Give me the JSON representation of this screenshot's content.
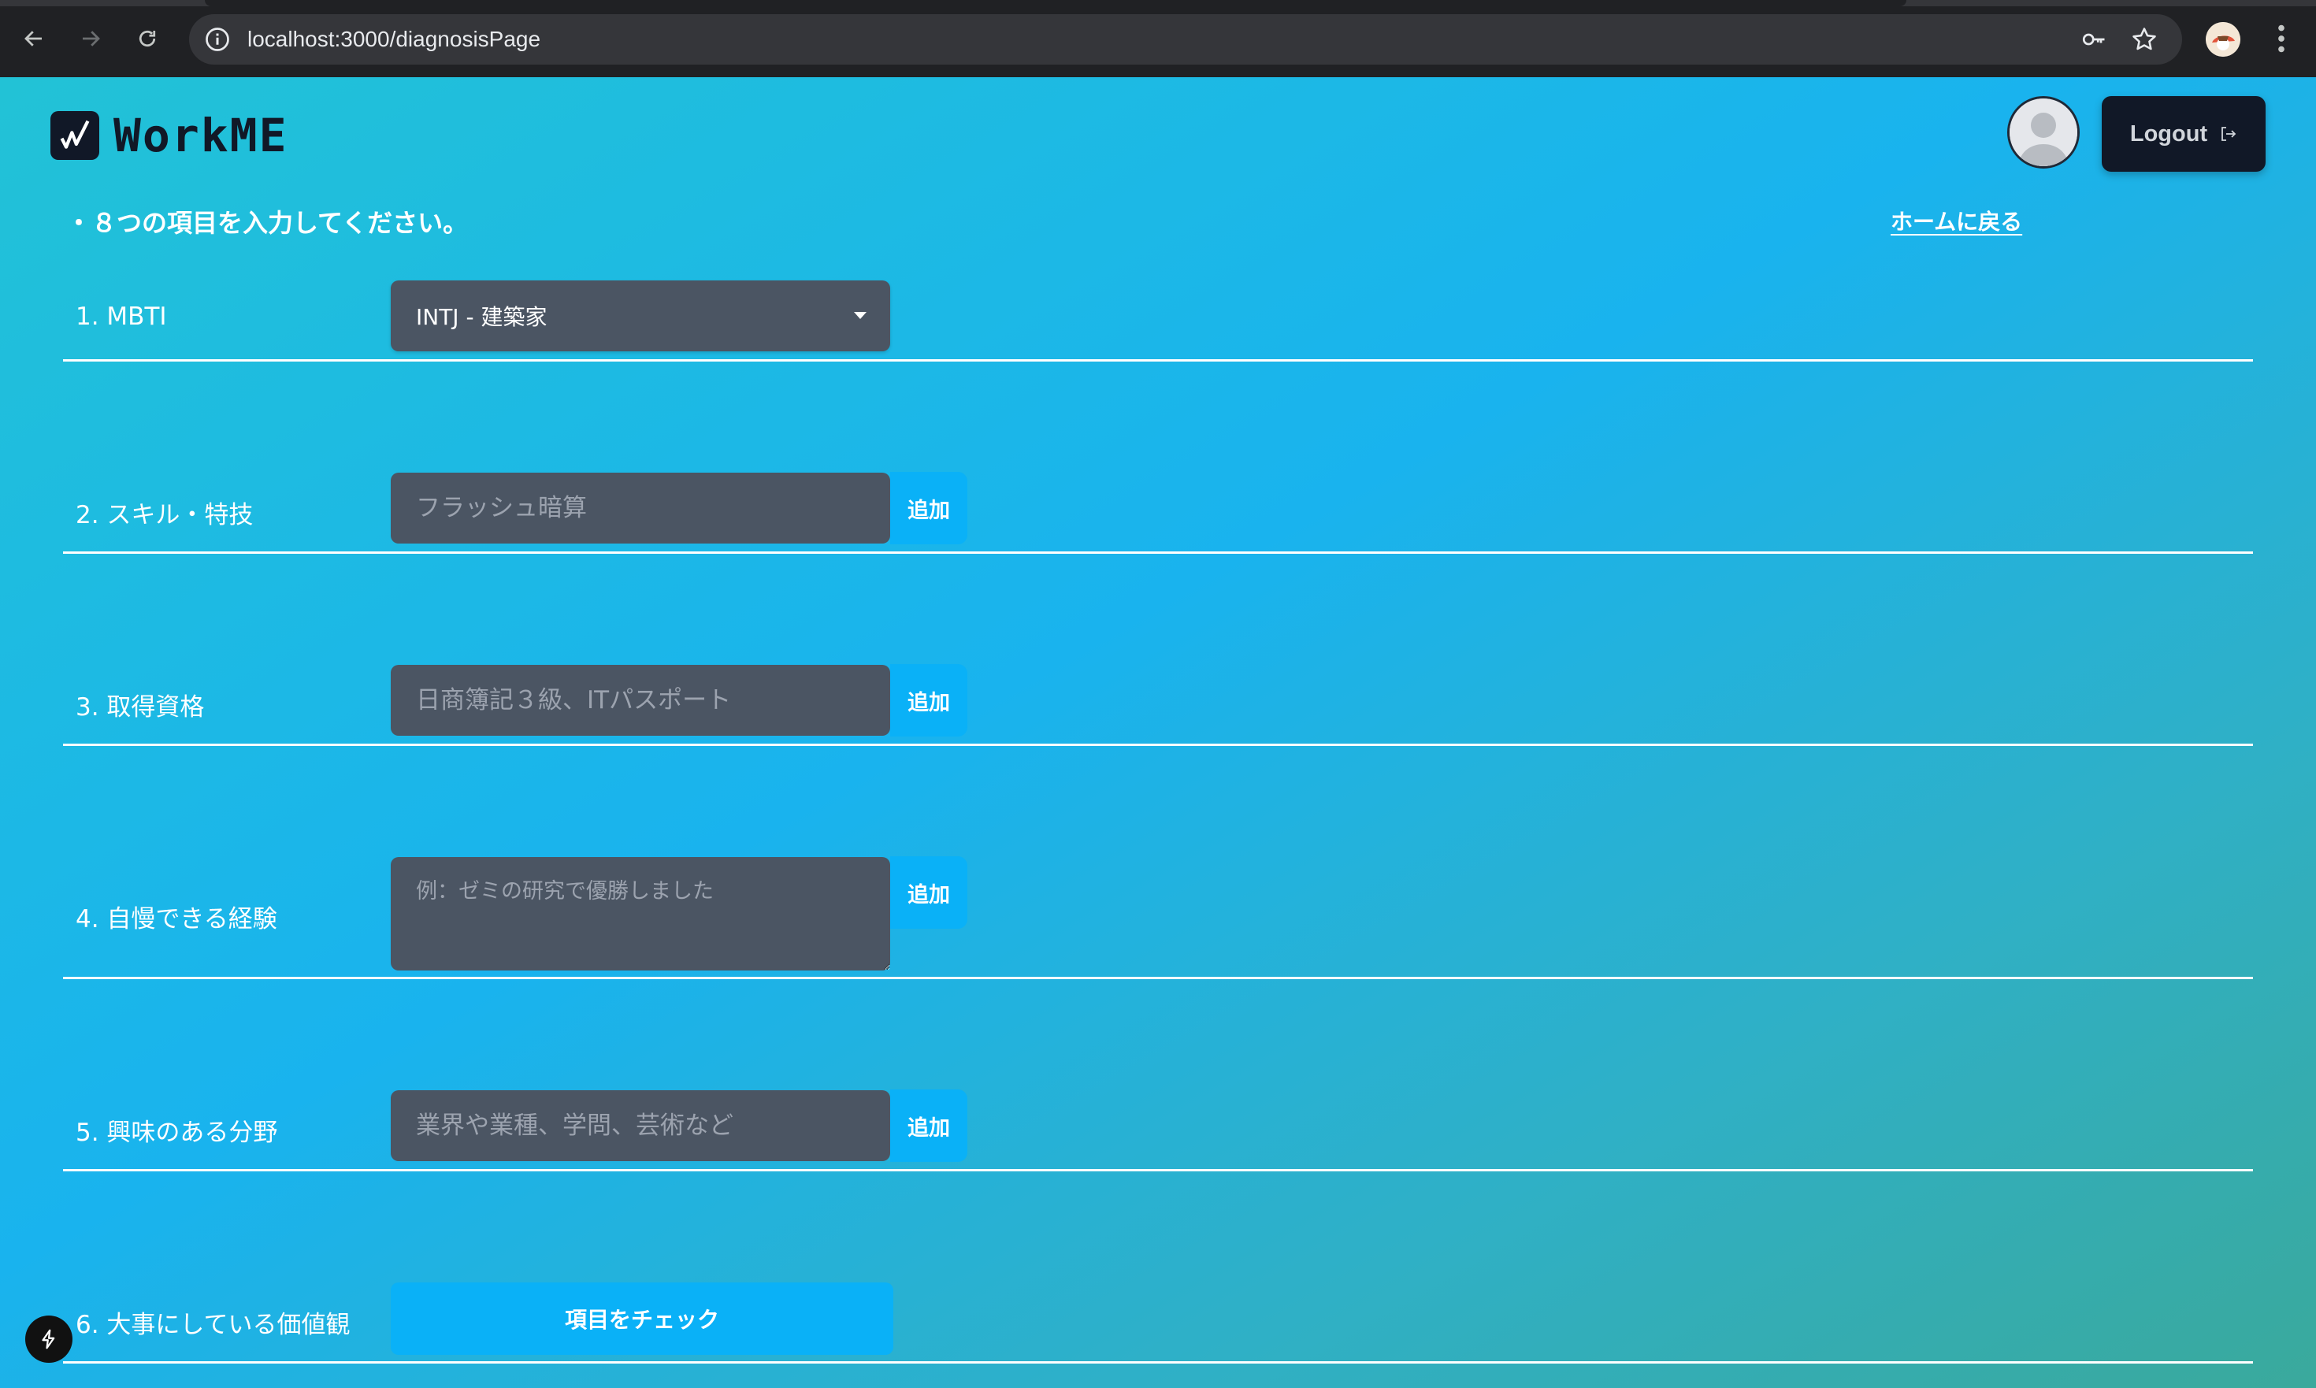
{
  "browser": {
    "url": "localhost:3000/diagnosisPage",
    "icons": [
      "back-icon",
      "forward-icon",
      "reload-icon",
      "info-icon",
      "key-icon",
      "star-icon",
      "profile-icon",
      "menu-icon"
    ]
  },
  "header": {
    "logo_text": "WorkME",
    "logout_label": "Logout"
  },
  "instruction": "・８つの項目を入力してください。",
  "home_link": "ホームに戻る",
  "rows": [
    {
      "label": "1. MBTI",
      "selected": "INTJ - 建築家"
    },
    {
      "label": "2. スキル・特技",
      "placeholder": "フラッシュ暗算",
      "button": "追加"
    },
    {
      "label": "3. 取得資格",
      "placeholder": "日商簿記３級、ITパスポート",
      "button": "追加"
    },
    {
      "label": "4. 自慢できる経験",
      "placeholder": "例：ゼミの研究で優勝しました",
      "button": "追加"
    },
    {
      "label": "5. 興味のある分野",
      "placeholder": "業界や業種、学問、芸術など",
      "button": "追加"
    },
    {
      "label": "6. 大事にしている価値観",
      "button": "項目をチェック"
    }
  ],
  "colors": {
    "accent_button": "#0ab1f7",
    "field_bg": "#4b5563",
    "header_button_bg": "#111827"
  }
}
